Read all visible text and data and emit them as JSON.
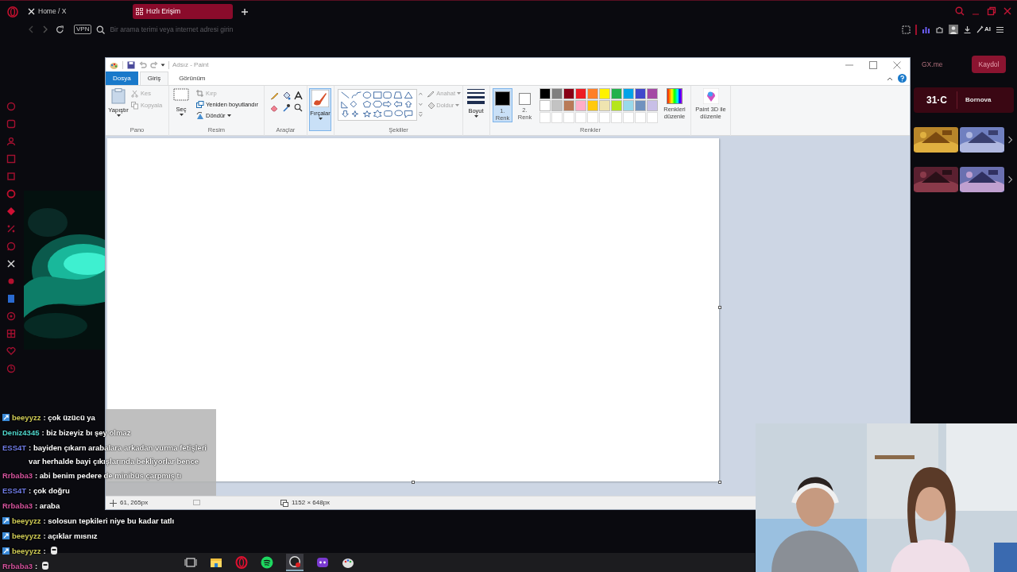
{
  "browser": {
    "tabs": [
      {
        "label": "Home / X",
        "selected": false,
        "kind": "x"
      },
      {
        "label": "Hızlı Erişim",
        "selected": true,
        "kind": "speed-dial"
      }
    ],
    "vpn": "VPN",
    "address": {
      "placeholder": "Bir arama terimi veya internet adresi girin"
    },
    "ai": "AI"
  },
  "paint": {
    "title": "Adsız - Paint",
    "ribbon_tabs": [
      {
        "label": "Dosya",
        "kind": "file"
      },
      {
        "label": "Giriş",
        "kind": "tab",
        "selected": true
      },
      {
        "label": "Görünüm",
        "kind": "tab",
        "selected": false
      }
    ],
    "clipboard": {
      "label": "Pano",
      "paste": "Yapıştır",
      "cut": {
        "label": "Kes",
        "disabled": true
      },
      "copy": {
        "label": "Kopyala",
        "disabled": true
      }
    },
    "image": {
      "label": "Resim",
      "select": "Seç",
      "crop": {
        "label": "Kırp",
        "disabled": true
      },
      "resize": {
        "label": "Yeniden boyutlandır",
        "disabled": false
      },
      "rotate": {
        "label": "Döndür",
        "disabled": false
      }
    },
    "tools": {
      "label": "Araçlar"
    },
    "brushes": {
      "label": "Fırçalar",
      "selected": true
    },
    "shapes": {
      "label": "Şekiller",
      "outline": {
        "label": "Anahat",
        "disabled": true
      },
      "fill": {
        "label": "Doldur",
        "disabled": true
      }
    },
    "size": {
      "label": "Boyut"
    },
    "colors": {
      "label": "Renkler",
      "color1": {
        "label": "1. Renk",
        "color": "#000000",
        "selected": true
      },
      "color2": {
        "label": "2. Renk",
        "color": "#ffffff",
        "selected": false
      },
      "palette": [
        {
          "color": "#000000"
        },
        {
          "color": "#7f7f7f"
        },
        {
          "color": "#880015"
        },
        {
          "color": "#ed1c24"
        },
        {
          "color": "#ff7f27"
        },
        {
          "color": "#fff200"
        },
        {
          "color": "#22b14c"
        },
        {
          "color": "#00a2e8"
        },
        {
          "color": "#3f48cc"
        },
        {
          "color": "#a349a4"
        },
        {
          "color": "#ffffff"
        },
        {
          "color": "#c3c3c3"
        },
        {
          "color": "#b97a57"
        },
        {
          "color": "#ffaec9"
        },
        {
          "color": "#ffc90e"
        },
        {
          "color": "#efe4b0"
        },
        {
          "color": "#b5e61d"
        },
        {
          "color": "#99d9ea"
        },
        {
          "color": "#7092be"
        },
        {
          "color": "#c8bfe7"
        },
        {
          "kind": "empty"
        },
        {
          "kind": "empty"
        },
        {
          "kind": "empty"
        },
        {
          "kind": "empty"
        },
        {
          "kind": "empty"
        },
        {
          "kind": "empty"
        },
        {
          "kind": "empty"
        },
        {
          "kind": "empty"
        },
        {
          "kind": "empty"
        },
        {
          "kind": "empty"
        }
      ]
    },
    "edit_colors": "Renkleri düzenle",
    "paint3d": "Paint 3D ile düzenle",
    "status": {
      "cursor": "61, 265px",
      "canvas_size": "1152 × 648px"
    }
  },
  "gx_panel": {
    "link": "GX.me",
    "signup": "Kaydol",
    "weather": {
      "temp": "31·C",
      "city": "Bornova"
    }
  },
  "chat": [
    {
      "user": "beeyyzz",
      "color": "#cfcb55",
      "badge": true,
      "kind": "text",
      "text": ": çok üzücü ya"
    },
    {
      "user": "Deniz4345",
      "color": "#4fd6cc",
      "badge": false,
      "kind": "text",
      "text": ": biz bizeyiz bı şey olmaz"
    },
    {
      "user": "ESS4T",
      "color": "#6f7be6",
      "badge": false,
      "kind": "text",
      "text": ": bayiden çıkarn arabalara arkadan vurma fetişleri var herhalde bayi çıkışlarında bekliyorlar bence"
    },
    {
      "user": "Rrbaba3",
      "color": "#d6549e",
      "badge": false,
      "kind": "text",
      "text": ": abi benim pedere de minibüs çarpmış tı"
    },
    {
      "user": "ESS4T",
      "color": "#6f7be6",
      "badge": false,
      "kind": "text",
      "text": ": çok doğru"
    },
    {
      "user": "Rrbaba3",
      "color": "#d6549e",
      "badge": false,
      "kind": "text",
      "text": ": araba"
    },
    {
      "user": "beeyyzz",
      "color": "#cfcb55",
      "badge": true,
      "kind": "text",
      "text": ": solosun tepkileri niye bu kadar tatlı"
    },
    {
      "user": "beeyyzz",
      "color": "#cfcb55",
      "badge": true,
      "kind": "text",
      "text": ": açıklar mısnız"
    },
    {
      "user": "beeyyzz",
      "color": "#cfcb55",
      "badge": true,
      "kind": "emote",
      "text": ":"
    },
    {
      "user": "Rrbaba3",
      "color": "#d6549e",
      "badge": false,
      "kind": "emote",
      "text": ":"
    }
  ]
}
